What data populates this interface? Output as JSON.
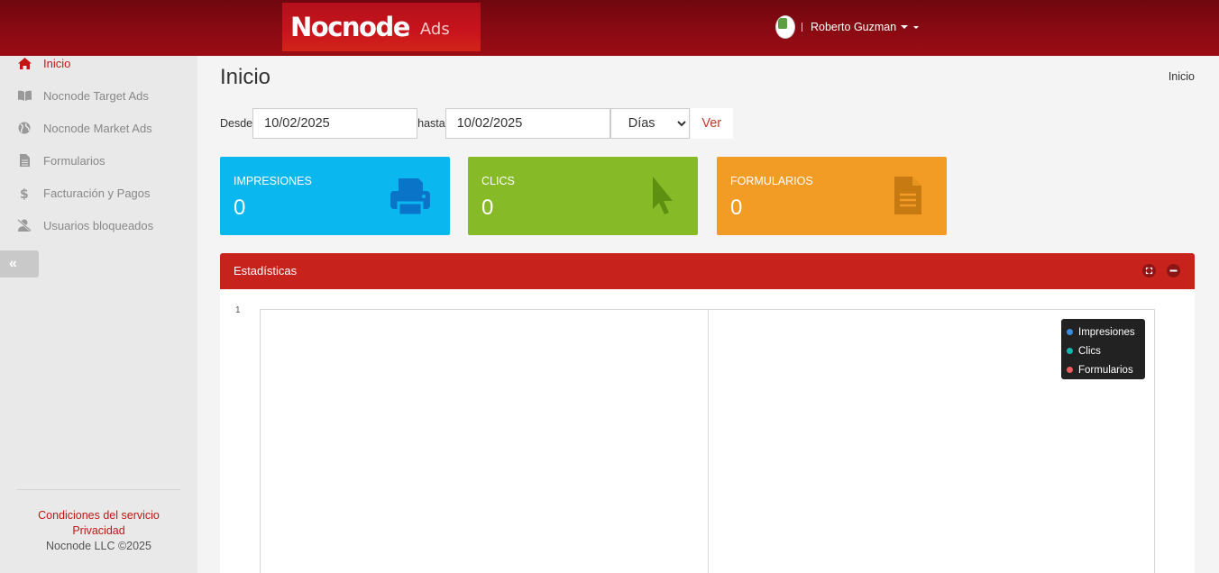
{
  "header": {
    "logo_main": "Nocnode",
    "logo_sub": "Ads",
    "user_name": "Roberto Guzman"
  },
  "sidebar": {
    "items": [
      {
        "label": "Inicio",
        "icon": "home-icon",
        "active": true
      },
      {
        "label": "Nocnode Target Ads",
        "icon": "book-icon",
        "active": false
      },
      {
        "label": "Nocnode Market Ads",
        "icon": "globe-icon",
        "active": false
      },
      {
        "label": "Formularios",
        "icon": "file-icon",
        "active": false
      },
      {
        "label": "Facturación y Pagos",
        "icon": "dollar-icon",
        "active": false
      },
      {
        "label": "Usuarios bloqueados",
        "icon": "user-slash-icon",
        "active": false
      }
    ],
    "collapse_label": "«",
    "footer": {
      "terms": "Condiciones del servicio",
      "privacy": "Privacidad",
      "copyright": "Nocnode LLC ©2025"
    }
  },
  "main": {
    "title": "Inicio",
    "breadcrumb": "Inicio",
    "filters": {
      "from_label": "Desde",
      "from_value": "10/02/2025",
      "to_label": "hasta",
      "to_value": "10/02/2025",
      "period_value": "Días",
      "submit_label": "Ver"
    },
    "stats": [
      {
        "label": "IMPRESIONES",
        "value": "0",
        "icon": "print-icon",
        "color": "#0ab7ef"
      },
      {
        "label": "CLICS",
        "value": "0",
        "icon": "mouse-pointer-icon",
        "color": "#86bb27"
      },
      {
        "label": "FORMULARIOS",
        "value": "0",
        "icon": "file-icon",
        "color": "#f29b25"
      }
    ],
    "panel": {
      "title": "Estadísticas"
    }
  },
  "chart_data": {
    "type": "line",
    "y_tick_labels": [
      "1"
    ],
    "series": [
      {
        "name": "Impresiones",
        "color": "#3c8dde",
        "values": []
      },
      {
        "name": "Clics",
        "color": "#14b5b0",
        "values": []
      },
      {
        "name": "Formularios",
        "color": "#f05b5b",
        "values": []
      }
    ],
    "legend": "top-right"
  }
}
